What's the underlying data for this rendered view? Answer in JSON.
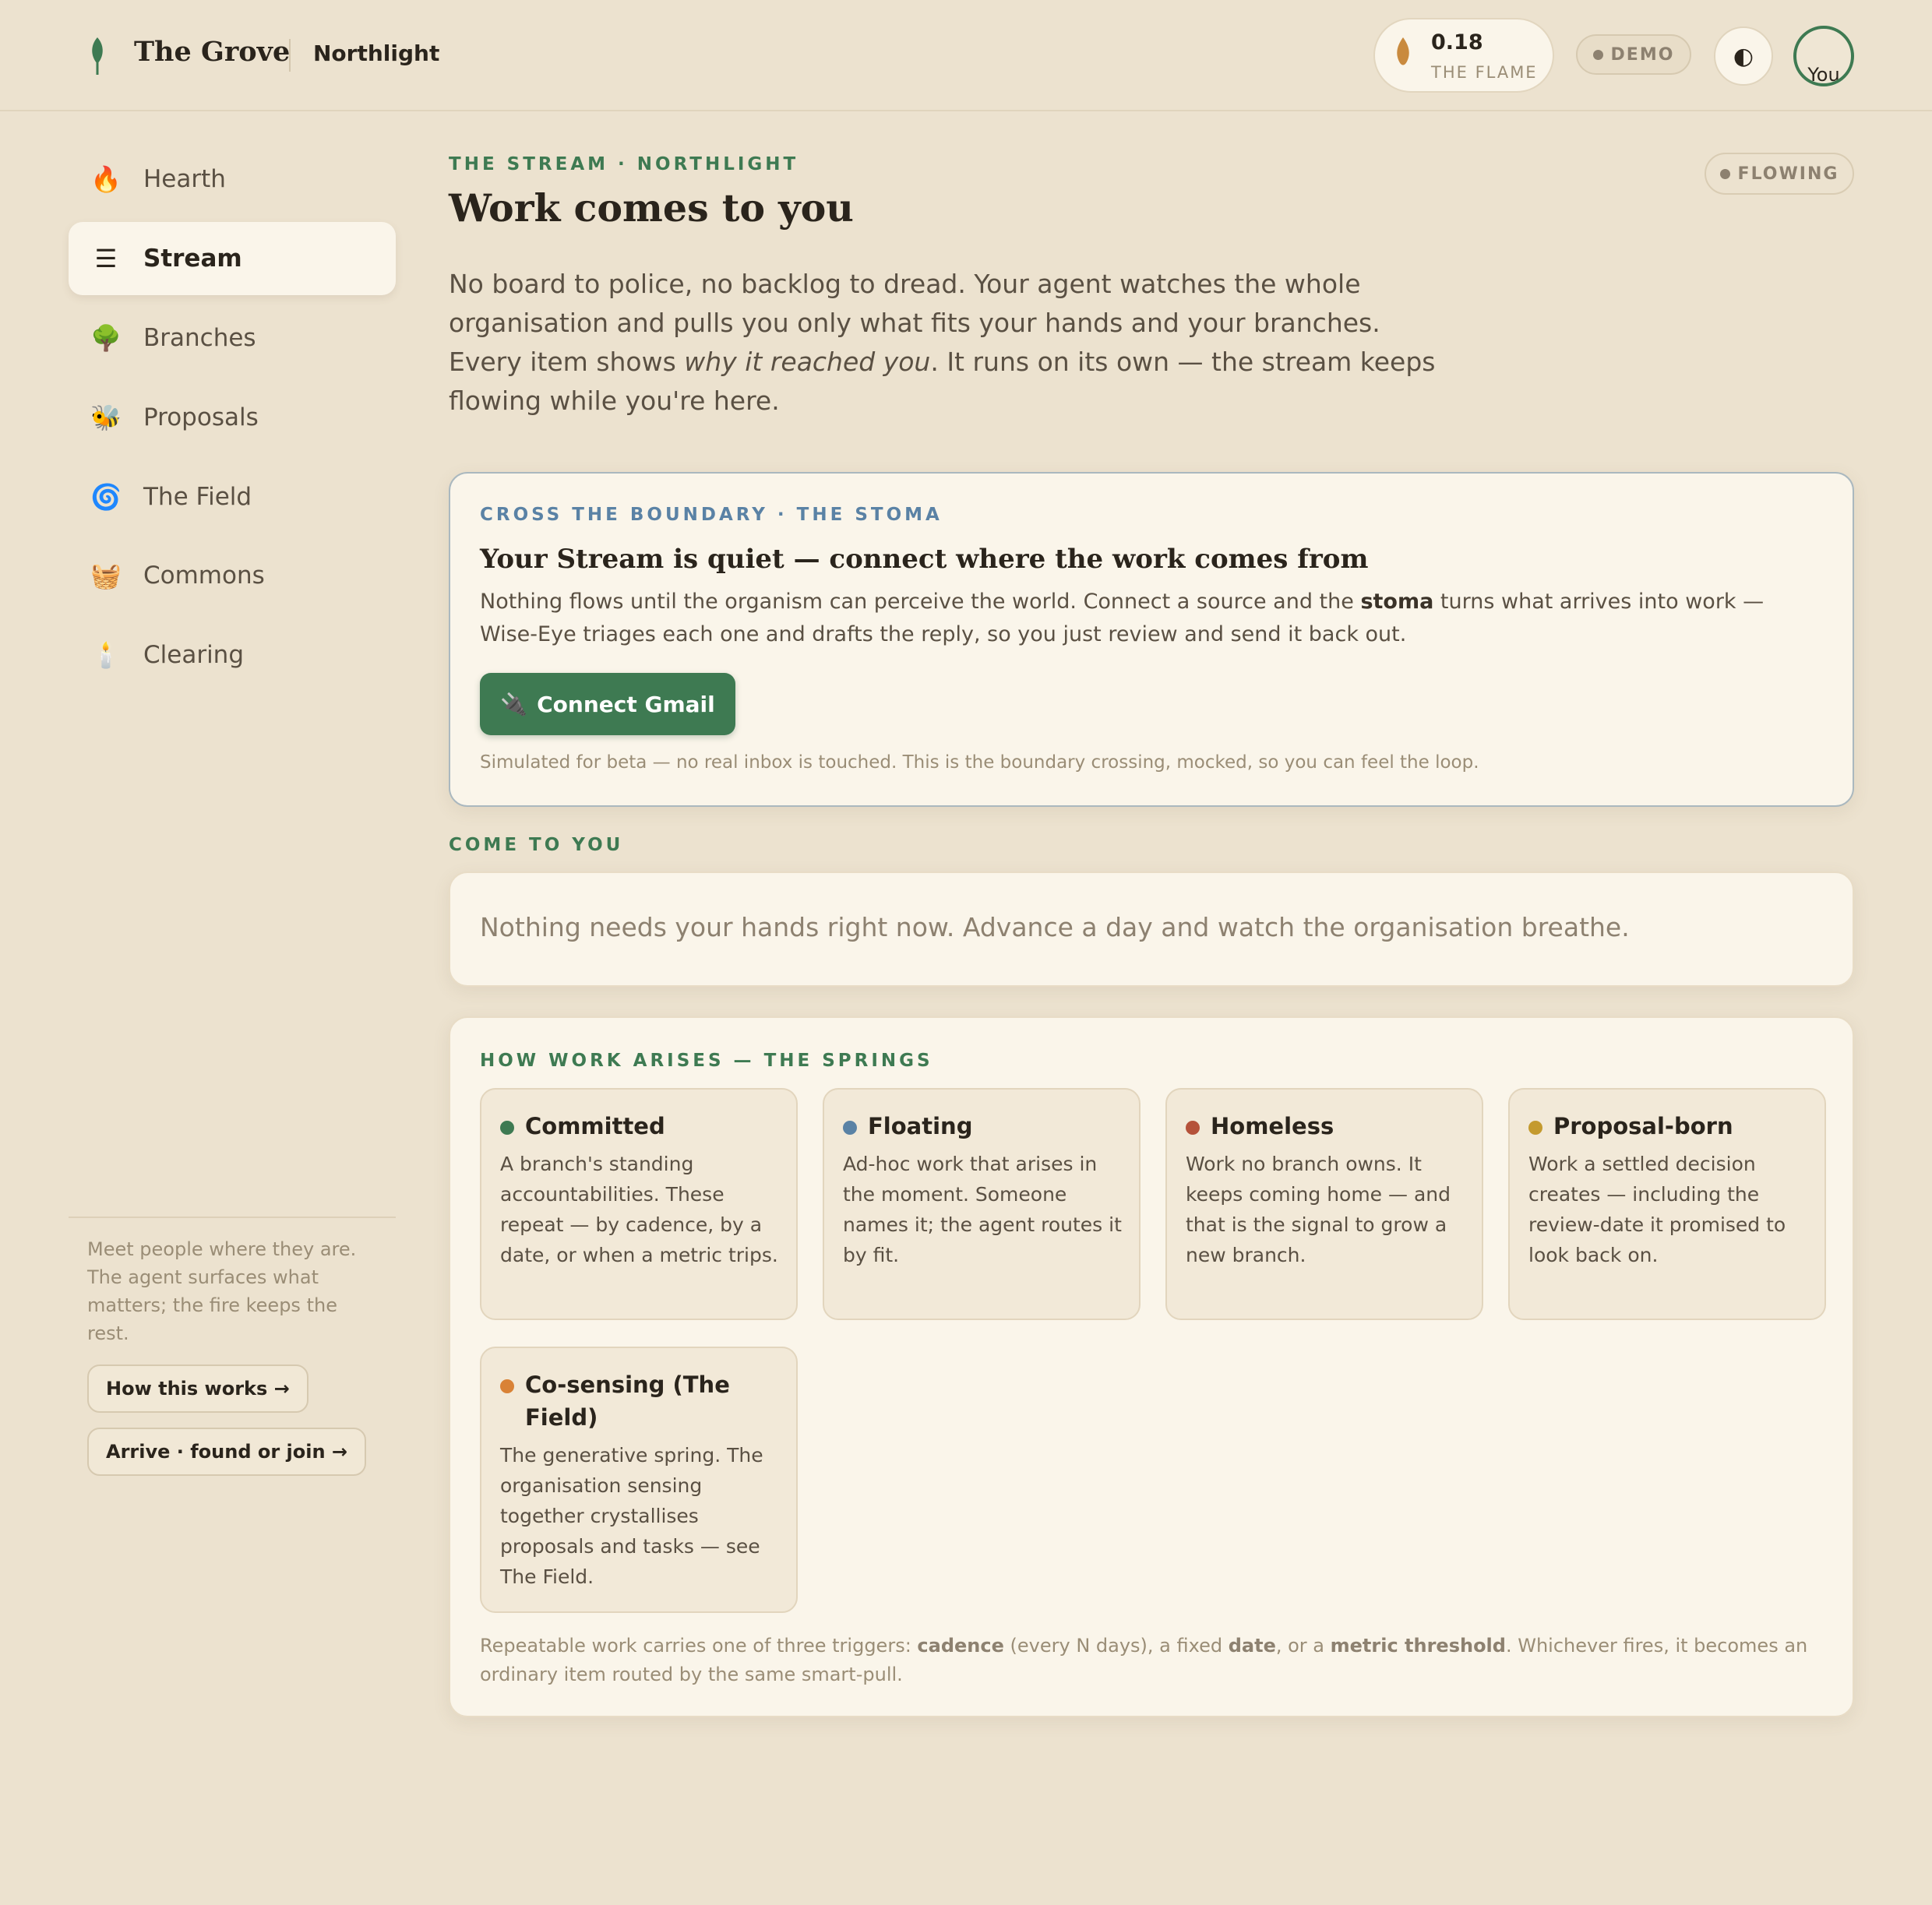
{
  "app": {
    "brand": "The Grove",
    "org": "Northlight"
  },
  "header": {
    "flame_value": "0.18",
    "flame_label": "THE FLAME",
    "demo_label": "DEMO",
    "theme_icon": "◐",
    "avatar_alt": "You"
  },
  "sidebar": {
    "items": [
      {
        "icon": "🔥",
        "icon_name": "fire-icon",
        "label": "Hearth",
        "active": false
      },
      {
        "icon": "☰",
        "icon_name": "menu-icon",
        "label": "Stream",
        "active": true
      },
      {
        "icon": "🌳",
        "icon_name": "tree-icon",
        "label": "Branches",
        "active": false
      },
      {
        "icon": "🐝",
        "icon_name": "bee-icon",
        "label": "Proposals",
        "active": false
      },
      {
        "icon": "🌀",
        "icon_name": "swirl-icon",
        "label": "The Field",
        "active": false
      },
      {
        "icon": "🧺",
        "icon_name": "basket-icon",
        "label": "Commons",
        "active": false
      },
      {
        "icon": "🕯️",
        "icon_name": "candle-icon",
        "label": "Clearing",
        "active": false
      }
    ],
    "note": "Meet people where they are. The agent surfaces what matters; the fire keeps the rest.",
    "how_button": "How this works →",
    "arrive_button": "Arrive · found or join →"
  },
  "page": {
    "eyebrow": "THE STREAM · NORTHLIGHT",
    "title": "Work comes to you",
    "status": "FLOWING",
    "intro_before": "No board to police, no backlog to dread. Your agent watches the whole organisation and pulls you only what fits your hands and your branches. Every item shows ",
    "intro_em": "why it reached you",
    "intro_after": ". It runs on its own — the stream keeps flowing while you're here."
  },
  "stoma": {
    "eyebrow": "CROSS THE BOUNDARY · THE STOMA",
    "title": "Your Stream is quiet — connect where the work comes from",
    "body_before": "Nothing flows until the organism can perceive the world. Connect a source and the ",
    "body_bold": "stoma",
    "body_after": " turns what arrives into work — Wise-Eye triages each one and drafts the reply, so you just review and send it back out.",
    "button_icon": "🔌",
    "button_label": "Connect Gmail",
    "note": "Simulated for beta — no real inbox is touched. This is the boundary crossing, mocked, so you can feel the loop."
  },
  "come": {
    "eyebrow": "COME TO YOU",
    "empty": "Nothing needs your hands right now. Advance a day and watch the organisation breathe."
  },
  "springs": {
    "eyebrow": "HOW WORK ARISES — THE SPRINGS",
    "items": [
      {
        "title": "Committed",
        "color": "#3e7a52",
        "body": "A branch's standing accountabilities. These repeat — by cadence, by a date, or when a metric trips."
      },
      {
        "title": "Floating",
        "color": "#5a82a5",
        "body": "Ad-hoc work that arises in the moment. Someone names it; the agent routes it by fit."
      },
      {
        "title": "Homeless",
        "color": "#b5523a",
        "body": "Work no branch owns. It keeps coming home — and that is the signal to grow a new branch."
      },
      {
        "title": "Proposal-born",
        "color": "#c49a2e",
        "body": "Work a settled decision creates — including the review-date it promised to look back on."
      },
      {
        "title": "Co-sensing (The Field)",
        "color": "#d98236",
        "body": "The generative spring. The organisation sensing together crystallises proposals and tasks — see The Field."
      }
    ],
    "foot_1": "Repeatable work carries one of three triggers: ",
    "foot_b1": "cadence",
    "foot_2": " (every N days), a fixed ",
    "foot_b2": "date",
    "foot_3": ", or a ",
    "foot_b3": "metric threshold",
    "foot_4": ". Whichever fires, it becomes an ordinary item routed by the same smart-pull."
  }
}
